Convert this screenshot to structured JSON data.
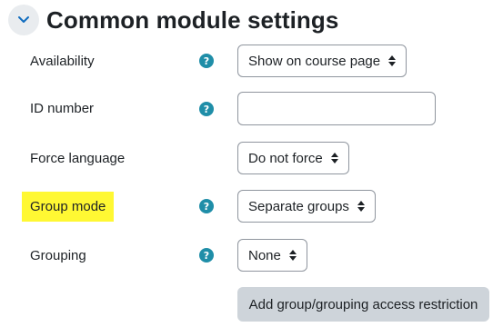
{
  "section": {
    "title": "Common module settings",
    "collapse_icon": "chevron-down-icon",
    "accent_color": "#0f6cbf"
  },
  "fields": {
    "availability": {
      "label": "Availability",
      "value": "Show on course page",
      "help_icon": "question-circle-icon"
    },
    "idnumber": {
      "label": "ID number",
      "value": "",
      "help_icon": "question-circle-icon"
    },
    "forcelanguage": {
      "label": "Force language",
      "value": "Do not force"
    },
    "groupmode": {
      "label": "Group mode",
      "value": "Separate groups",
      "help_icon": "question-circle-icon",
      "highlight_color": "#fff833"
    },
    "grouping": {
      "label": "Grouping",
      "value": "None",
      "help_icon": "question-circle-icon"
    }
  },
  "help_glyph": "?",
  "actions": {
    "add_restriction_label": "Add group/grouping access restriction"
  }
}
